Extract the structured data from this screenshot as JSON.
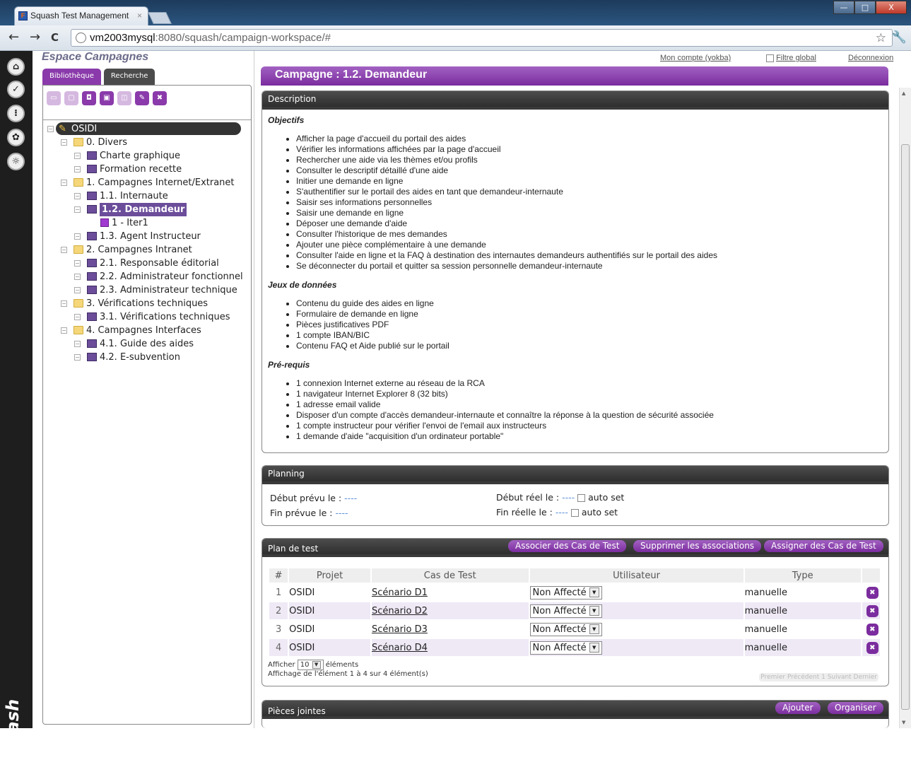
{
  "browser": {
    "tab_title": "Squash Test Management",
    "tab_close": "×",
    "url_host": "vm2003mysql",
    "url_rest": ":8080/squash/campaign-workspace/#",
    "back": "←",
    "forward": "→",
    "reload": "C",
    "star": "☆",
    "wrench": "🔧"
  },
  "window": {
    "minimize": "—",
    "maximize": "□",
    "close": "X"
  },
  "sidenav": {
    "logo": "squash"
  },
  "left": {
    "title": "Espace Campagnes",
    "tabs": [
      "Bibliothèque",
      "Recherche"
    ],
    "tree": [
      {
        "label": "OSIDI",
        "depth": 0,
        "kind": "root"
      },
      {
        "label": "0. Divers",
        "depth": 1,
        "kind": "folder"
      },
      {
        "label": "Charte graphique",
        "depth": 2,
        "kind": "camp"
      },
      {
        "label": "Formation recette",
        "depth": 2,
        "kind": "camp"
      },
      {
        "label": "1. Campagnes Internet/Extranet",
        "depth": 1,
        "kind": "folder"
      },
      {
        "label": "1.1. Internaute",
        "depth": 2,
        "kind": "camp"
      },
      {
        "label": "1.2. Demandeur",
        "depth": 2,
        "kind": "camp",
        "selected": true
      },
      {
        "label": "1 - Iter1",
        "depth": 3,
        "kind": "iter"
      },
      {
        "label": "1.3. Agent Instructeur",
        "depth": 2,
        "kind": "camp"
      },
      {
        "label": "2. Campagnes Intranet",
        "depth": 1,
        "kind": "folder"
      },
      {
        "label": "2.1. Responsable éditorial",
        "depth": 2,
        "kind": "camp"
      },
      {
        "label": "2.2. Administrateur fonctionnel",
        "depth": 2,
        "kind": "camp"
      },
      {
        "label": "2.3. Administrateur technique",
        "depth": 2,
        "kind": "camp"
      },
      {
        "label": "3. Vérifications techniques",
        "depth": 1,
        "kind": "folder"
      },
      {
        "label": "3.1. Vérifications techniques",
        "depth": 2,
        "kind": "camp"
      },
      {
        "label": "4. Campagnes Interfaces",
        "depth": 1,
        "kind": "folder"
      },
      {
        "label": "4.1. Guide des aides",
        "depth": 2,
        "kind": "camp"
      },
      {
        "label": "4.2. E-subvention",
        "depth": 2,
        "kind": "camp"
      }
    ]
  },
  "top_links": {
    "account": "Mon compte (yokba)",
    "filter": "Filtre global",
    "logout": "Déconnexion"
  },
  "campaign_title": "Campagne : 1.2. Demandeur",
  "description": {
    "header": "Description",
    "sections": [
      {
        "title": "Objectifs",
        "items": [
          "Afficher la page d'accueil du portail des aides",
          "Vérifier les informations affichées par la page d'accueil",
          "Rechercher une aide via les thèmes et/ou profils",
          "Consulter le descriptif détaillé d'une aide",
          "Initier une demande en ligne",
          "S'authentifier sur le portail des aides en tant que demandeur-internaute",
          "Saisir ses informations personnelles",
          "Saisir une demande en ligne",
          "Déposer une demande d'aide",
          "Consulter l'historique de mes demandes",
          "Ajouter une pièce complémentaire à une demande",
          "Consulter l'aide en ligne et la FAQ à destination des internautes demandeurs authentifiés sur le portail des aides",
          "Se déconnecter du portail et quitter sa session personnelle demandeur-internaute"
        ]
      },
      {
        "title": "Jeux de données",
        "items": [
          "Contenu du guide des aides en ligne",
          "Formulaire de demande en ligne",
          "Pièces justificatives PDF",
          "1 compte IBAN/BIC",
          "Contenu FAQ et Aide publié sur le portail"
        ]
      },
      {
        "title": "Pré-requis",
        "items": [
          "1 connexion Internet externe au réseau de la RCA",
          "1 navigateur Internet Explorer 8 (32 bits)",
          "1 adresse email valide",
          "Disposer d'un compte d'accès demandeur-internaute et connaître la réponse à la question de sécurité associée",
          "1 compte instructeur pour vérifier l'envoi de l'email aux instructeurs",
          "1 demande d'aide \"acquisition d'un ordinateur portable\""
        ]
      }
    ]
  },
  "planning": {
    "header": "Planning",
    "start_planned_label": "Début prévu le :",
    "start_planned_value": "----",
    "end_planned_label": "Fin prévue le :",
    "end_planned_value": "----",
    "start_real_label": "Début réel le :",
    "start_real_value": "----",
    "end_real_label": "Fin réelle le :",
    "end_real_value": "----",
    "auto_set": "auto set"
  },
  "test_plan": {
    "header": "Plan de test",
    "buttons": [
      "Associer des Cas de Test",
      "Supprimer les associations",
      "Assigner des Cas de Test"
    ],
    "columns": [
      "#",
      "Projet",
      "Cas de Test",
      "Utilisateur",
      "Type",
      ""
    ],
    "rows": [
      {
        "num": "1",
        "project": "OSIDI",
        "case": "Scénario D1",
        "user": "Non Affecté",
        "type": "manuelle"
      },
      {
        "num": "2",
        "project": "OSIDI",
        "case": "Scénario D2",
        "user": "Non Affecté",
        "type": "manuelle"
      },
      {
        "num": "3",
        "project": "OSIDI",
        "case": "Scénario D3",
        "user": "Non Affecté",
        "type": "manuelle"
      },
      {
        "num": "4",
        "project": "OSIDI",
        "case": "Scénario D4",
        "user": "Non Affecté",
        "type": "manuelle"
      }
    ],
    "show_label": "Afficher",
    "show_value": "10",
    "elements_label": "éléments",
    "summary": "Affichage de l'élément 1 à 4 sur 4 élément(s)",
    "pager": "Premier Précédent 1 Suivant Dernier"
  },
  "attachments": {
    "header": "Pièces jointes",
    "buttons": [
      "Ajouter",
      "Organiser"
    ]
  },
  "colors": {
    "accent": "#8a3aaa",
    "dark_header": "#3a3a3a"
  }
}
